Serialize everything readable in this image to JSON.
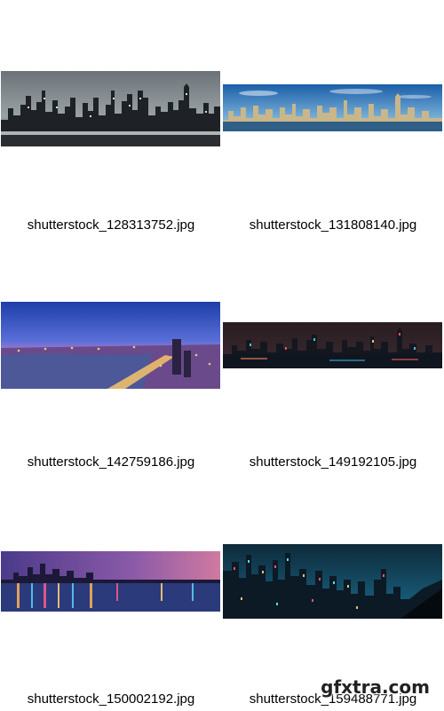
{
  "gallery": {
    "items": [
      {
        "filename": "shutterstock_128313752.jpg"
      },
      {
        "filename": "shutterstock_131808140.jpg"
      },
      {
        "filename": "shutterstock_142759186.jpg"
      },
      {
        "filename": "shutterstock_149192105.jpg"
      },
      {
        "filename": "shutterstock_150002192.jpg"
      },
      {
        "filename": "shutterstock_159488771.jpg"
      }
    ]
  },
  "watermark": {
    "text": "gfxtra.com"
  }
}
